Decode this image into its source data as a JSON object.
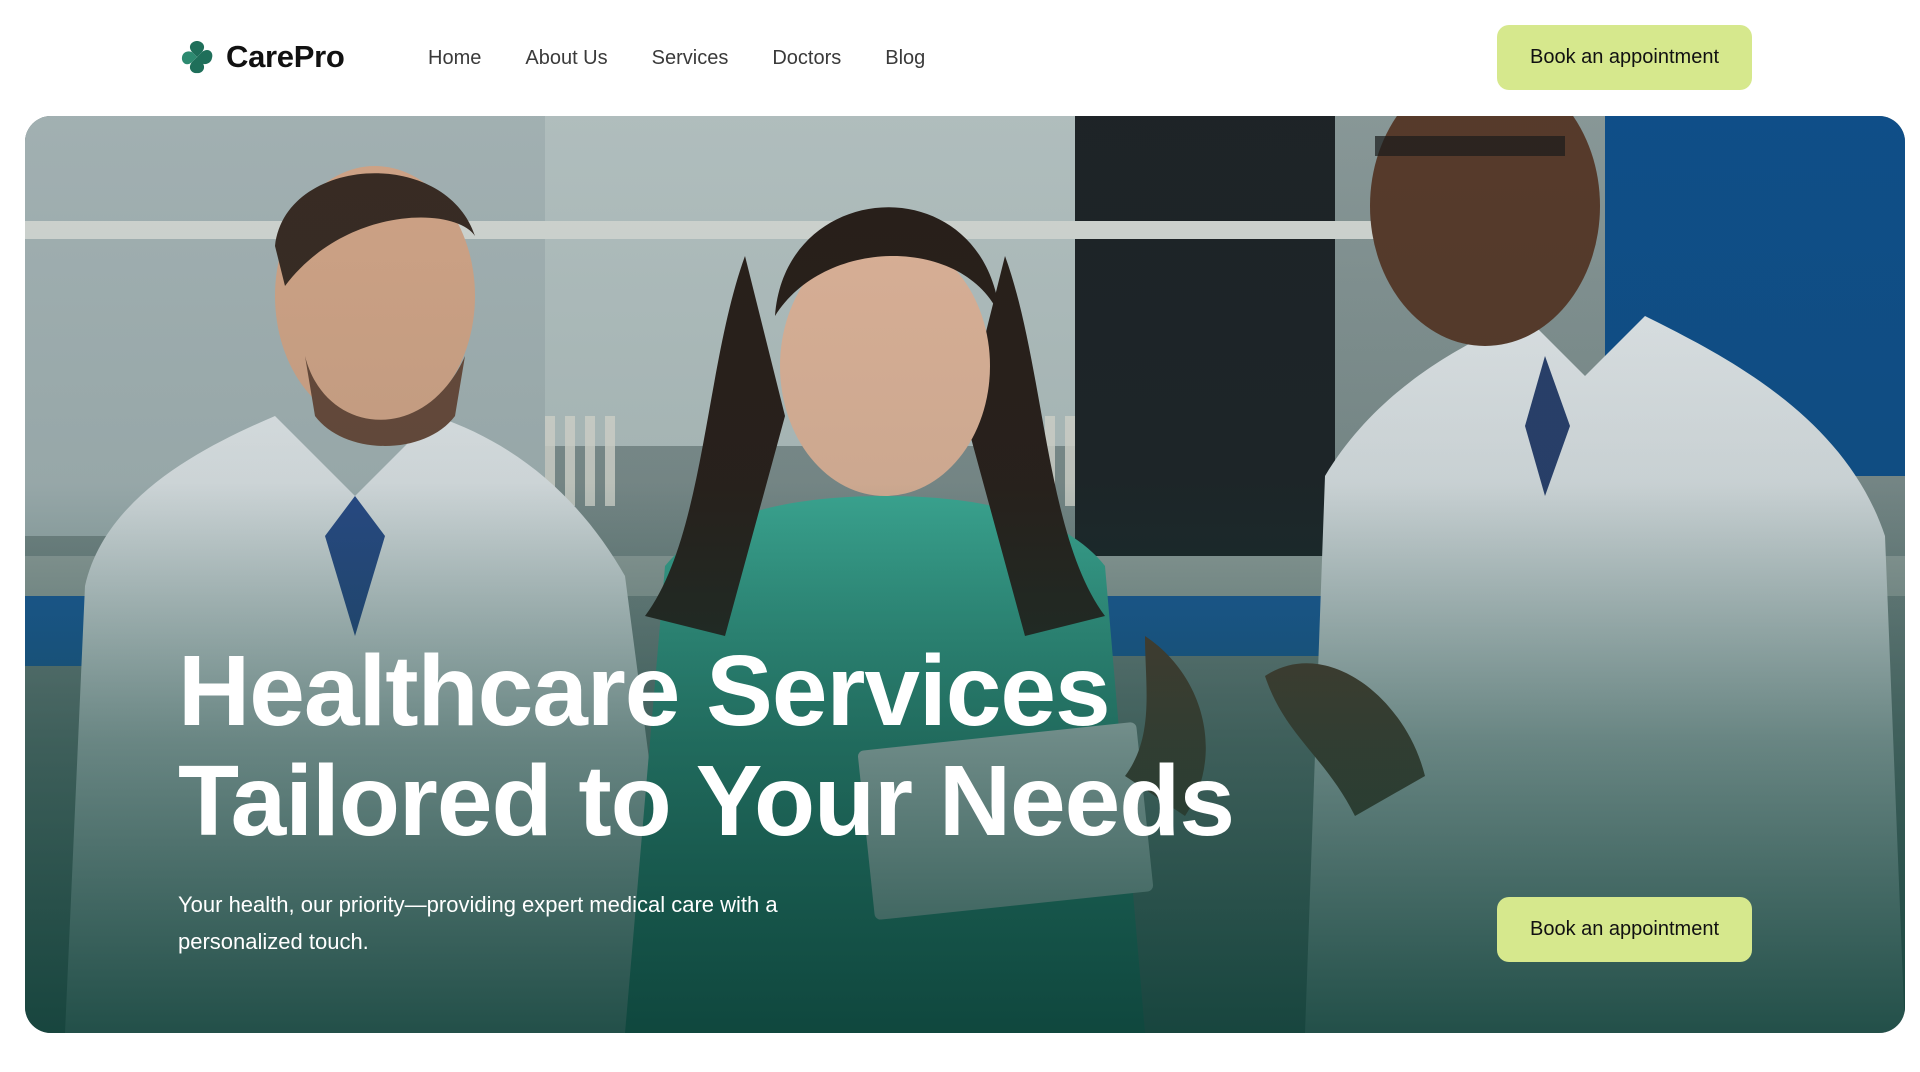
{
  "brand": {
    "name": "CarePro",
    "icon": "carepro-leaf-logo",
    "color": "#1f6f5a"
  },
  "nav": {
    "items": [
      {
        "label": "Home"
      },
      {
        "label": "About Us"
      },
      {
        "label": "Services"
      },
      {
        "label": "Doctors"
      },
      {
        "label": "Blog"
      }
    ]
  },
  "header": {
    "cta_label": "Book an appointment"
  },
  "hero": {
    "title_line1": "Healthcare Services",
    "title_line2": "Tailored to Your Needs",
    "subtitle": "Your health, our priority—providing expert medical care with a personalized touch.",
    "cta_label": "Book an appointment",
    "image_subject": "three-medical-professionals-photo"
  },
  "colors": {
    "accent": "#d6e88d",
    "overlay": "#0c3e36",
    "text_dark": "#111111",
    "nav_text": "#3a3a3a"
  }
}
